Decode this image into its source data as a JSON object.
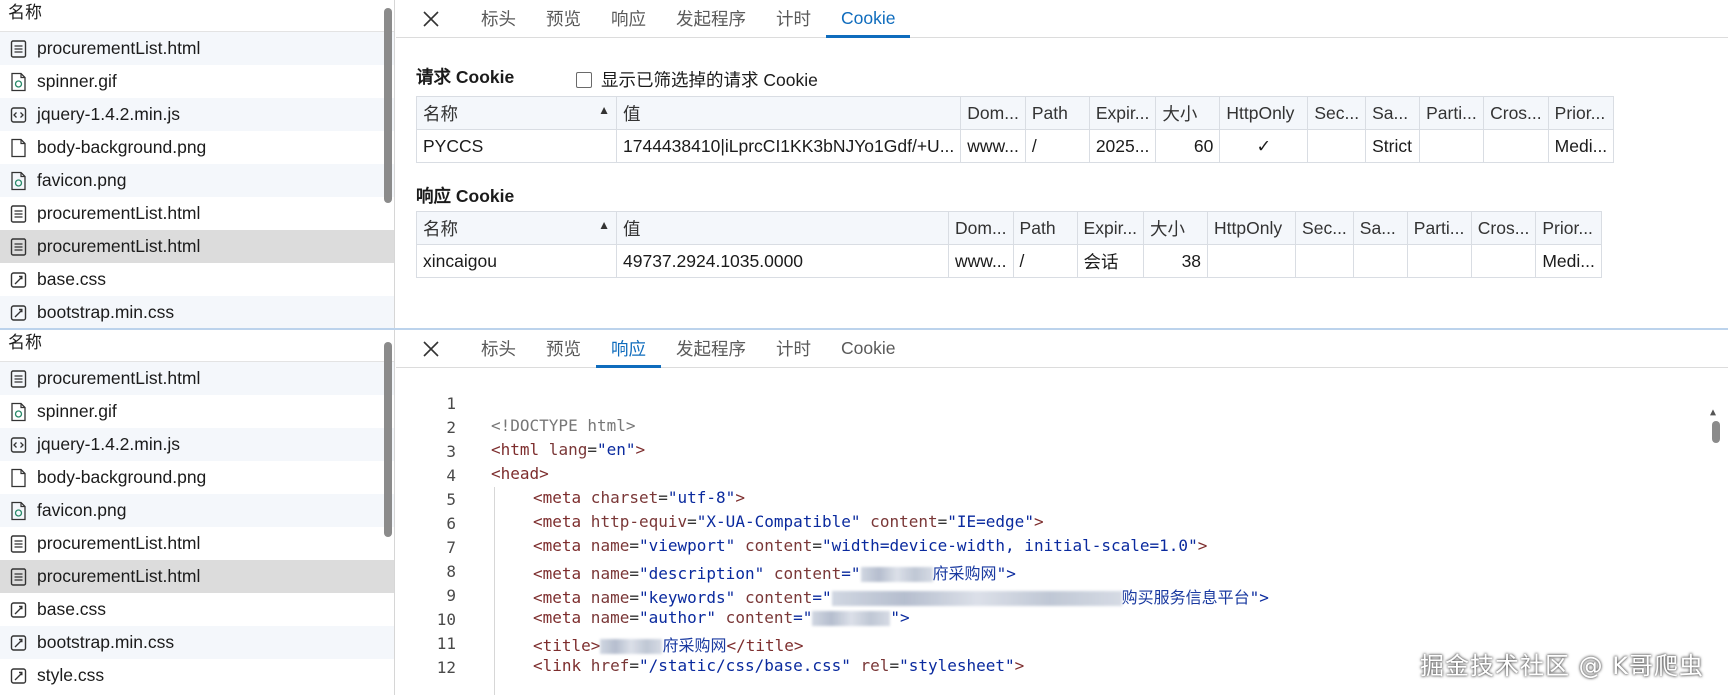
{
  "file_list": {
    "header": "名称",
    "top_items": [
      {
        "name": "procurementList.html",
        "icon": "document-icon",
        "state": "alt"
      },
      {
        "name": "spinner.gif",
        "icon": "image-file-icon",
        "state": ""
      },
      {
        "name": "jquery-1.4.2.min.js",
        "icon": "script-file-icon",
        "state": "alt"
      },
      {
        "name": "body-background.png",
        "icon": "blank-file-icon",
        "state": ""
      },
      {
        "name": "favicon.png",
        "icon": "image-file-icon",
        "state": "alt"
      },
      {
        "name": "procurementList.html",
        "icon": "document-icon",
        "state": ""
      },
      {
        "name": "procurementList.html",
        "icon": "document-icon",
        "state": "selected"
      },
      {
        "name": "base.css",
        "icon": "stylesheet-icon",
        "state": ""
      },
      {
        "name": "bootstrap.min.css",
        "icon": "stylesheet-icon",
        "state": "alt"
      }
    ],
    "bottom_items": [
      {
        "name": "procurementList.html",
        "icon": "document-icon",
        "state": "alt"
      },
      {
        "name": "spinner.gif",
        "icon": "image-file-icon",
        "state": ""
      },
      {
        "name": "jquery-1.4.2.min.js",
        "icon": "script-file-icon",
        "state": "alt"
      },
      {
        "name": "body-background.png",
        "icon": "blank-file-icon",
        "state": ""
      },
      {
        "name": "favicon.png",
        "icon": "image-file-icon",
        "state": "alt"
      },
      {
        "name": "procurementList.html",
        "icon": "document-icon",
        "state": ""
      },
      {
        "name": "procurementList.html",
        "icon": "document-icon",
        "state": "selected"
      },
      {
        "name": "base.css",
        "icon": "stylesheet-icon",
        "state": ""
      },
      {
        "name": "bootstrap.min.css",
        "icon": "stylesheet-icon",
        "state": "alt"
      },
      {
        "name": "style.css",
        "icon": "stylesheet-icon",
        "state": ""
      }
    ]
  },
  "tabs_top": {
    "items": [
      "标头",
      "预览",
      "响应",
      "发起程序",
      "计时",
      "Cookie"
    ],
    "active": 5
  },
  "tabs_bottom": {
    "items": [
      "标头",
      "预览",
      "响应",
      "发起程序",
      "计时",
      "Cookie"
    ],
    "active": 2
  },
  "cookies": {
    "request_title": "请求 Cookie",
    "response_title": "响应 Cookie",
    "filter_label": "显示已筛选掉的请求 Cookie",
    "columns": [
      "名称",
      "值",
      "Dom...",
      "Path",
      "Expir...",
      "大小",
      "HttpOnly",
      "Sec...",
      "Sa...",
      "Parti...",
      "Cros...",
      "Prior..."
    ],
    "request_rows": [
      [
        "PYCCS",
        "1744438410|iLprcCI1KK3bNJYo1Gdf/+U...",
        "www...",
        "/",
        "2025...",
        "60",
        "✓",
        "",
        "Strict",
        "",
        "",
        "Medi..."
      ]
    ],
    "response_rows": [
      [
        "xincaigou",
        "49737.2924.1035.0000",
        "www...",
        "/",
        "会话",
        "38",
        "",
        "",
        "",
        "",
        "",
        "Medi..."
      ]
    ]
  },
  "code": {
    "line_numbers": [
      "1",
      "2",
      "3",
      "4",
      "5",
      "6",
      "7",
      "8",
      "9",
      "10",
      "11",
      "12"
    ],
    "line2": "<!DOCTYPE html>",
    "l3": {
      "open": "<html",
      "attr": " lang",
      "eq": "=",
      "val": "\"en\"",
      "close": ">"
    },
    "l4": "<head>",
    "l5": {
      "open": "<meta",
      "attr": " charset",
      "eq": "=",
      "val": "\"utf-8\"",
      "close": ">"
    },
    "l6": {
      "open": "<meta",
      "a1": " http-equiv",
      "v1": "\"X-UA-Compatible\"",
      "a2": " content",
      "v2": "\"IE=edge\"",
      "close": ">"
    },
    "l7": {
      "open": "<meta",
      "a1": " name",
      "v1": "\"viewport\"",
      "a2": " content",
      "v2": "\"width=device-width, initial-scale=1.0\"",
      "close": ">"
    },
    "l8": {
      "open": "<meta",
      "a1": " name",
      "v1": "\"description\"",
      "a2": " content",
      "q": "=\"",
      "cjk": "府采购网",
      "end": "\">"
    },
    "l9": {
      "open": "<meta",
      "a1": " name",
      "v1": "\"keywords\"",
      "a2": " content",
      "q": "=\"",
      "cjk": "购买服务信息平台",
      "end": "\">"
    },
    "l10": {
      "open": "<meta",
      "a1": " name",
      "v1": "\"author\"",
      "a2": " content",
      "q": "=\"",
      "end": "\">"
    },
    "l11": {
      "open": "<title>",
      "cjk": "府采购网",
      "close": "</title>"
    },
    "l12": {
      "open": "<link",
      "a1": " href",
      "v1": "\"/static/css/base.css\"",
      "a2": " rel",
      "v2": "\"stylesheet\"",
      "close": ">"
    }
  },
  "watermark": "掘金技术社区 @ K哥爬虫"
}
